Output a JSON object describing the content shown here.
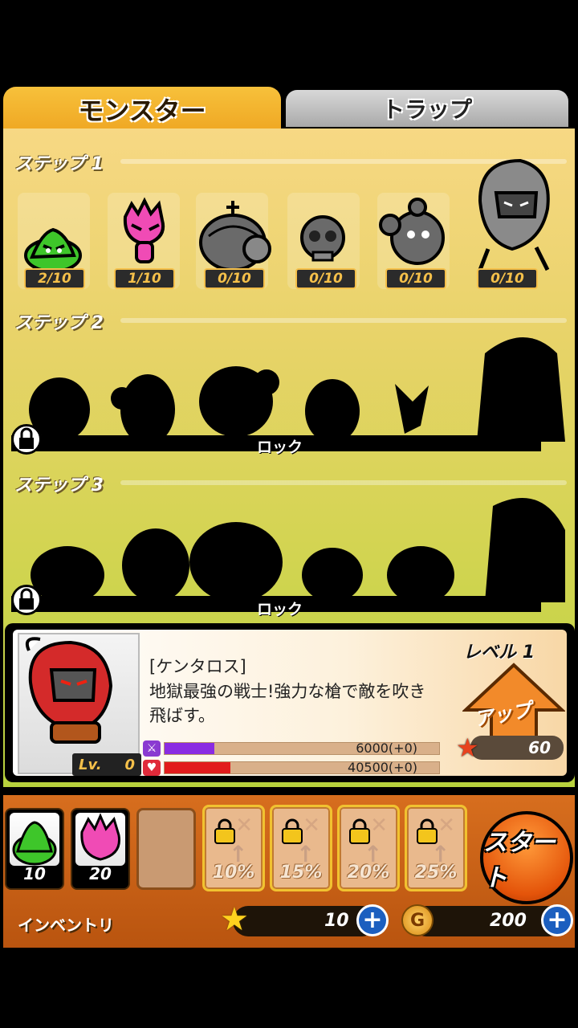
{
  "tabs": {
    "monster": "モンスター",
    "trap": "トラップ"
  },
  "steps": [
    {
      "label": "ステップ 1"
    },
    {
      "label": "ステップ 2",
      "lock_text": "ロック"
    },
    {
      "label": "ステップ 3",
      "lock_text": "ロック"
    }
  ],
  "step1_monsters": [
    {
      "count": "2/10",
      "color": "#3ec62a"
    },
    {
      "count": "1/10",
      "color": "#f04bb5"
    },
    {
      "count": "0/10",
      "color": "#6a6a6a"
    },
    {
      "count": "0/10",
      "color": "#6a6a6a"
    },
    {
      "count": "0/10",
      "color": "#6a6a6a"
    },
    {
      "count": "0/10",
      "color": "#6a6a6a"
    }
  ],
  "detail": {
    "name": "[ケンタロス]",
    "description": "地獄最強の戦士!強力な槍で敵を吹き飛ばす。",
    "lv_label": "Lv.",
    "lv_value": "0",
    "attack_text": "6000(+0)",
    "hp_text": "40500(+0)",
    "attack_fill": 0.18,
    "hp_fill": 0.24,
    "level_label": "レベル 1",
    "up_label": "アップ",
    "up_cost": "60"
  },
  "inventory": {
    "label": "インベントリ",
    "slots": [
      {
        "num": "10",
        "color": "#3ec62a"
      },
      {
        "num": "20",
        "color": "#f04bb5"
      }
    ],
    "locked": [
      "10%",
      "15%",
      "20%",
      "25%"
    ]
  },
  "start_label": "スタート",
  "resources": {
    "stars": "10",
    "gold": "200",
    "coin_glyph": "G"
  }
}
